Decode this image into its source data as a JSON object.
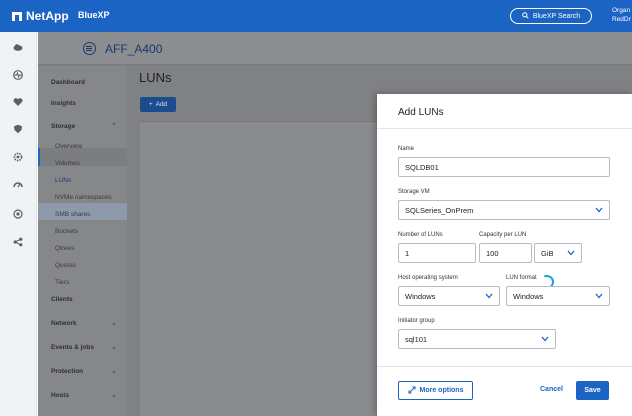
{
  "header": {
    "brand": "NetApp",
    "product": "BlueXP",
    "search_label": "BlueXP Search",
    "org_line1": "Organ",
    "org_line2": "RedDr"
  },
  "left_rail": {
    "icons": [
      "cloud-icon",
      "health-icon",
      "heart-shield-icon",
      "shield-icon",
      "gear-icon",
      "speed-icon",
      "target-icon",
      "share-icon"
    ]
  },
  "object": {
    "title": "AFF_A400"
  },
  "sidebar": {
    "items": [
      {
        "label": "Dashboard",
        "type": "top"
      },
      {
        "label": "Insights",
        "type": "top"
      },
      {
        "label": "Storage",
        "type": "top",
        "expanded": true
      },
      {
        "label": "Overview",
        "type": "sub"
      },
      {
        "label": "Volumes",
        "type": "sub"
      },
      {
        "label": "LUNs",
        "type": "sub",
        "active": true
      },
      {
        "label": "NVMe namespaces",
        "type": "sub"
      },
      {
        "label": "SMB shares",
        "type": "sub"
      },
      {
        "label": "Buckets",
        "type": "sub"
      },
      {
        "label": "Qtrees",
        "type": "sub"
      },
      {
        "label": "Quotas",
        "type": "sub"
      },
      {
        "label": "Tiers",
        "type": "sub"
      },
      {
        "label": "Clients",
        "type": "top"
      },
      {
        "label": "Network",
        "type": "top"
      },
      {
        "label": "Events & jobs",
        "type": "top"
      },
      {
        "label": "Protection",
        "type": "top"
      },
      {
        "label": "Hosts",
        "type": "top"
      }
    ]
  },
  "main": {
    "title": "LUNs",
    "add_label": "Add"
  },
  "modal": {
    "title": "Add LUNs",
    "name_label": "Name",
    "name_value": "SQLDB01",
    "svm_label": "Storage VM",
    "svm_value": "SQLSeries_OnPrem",
    "num_label": "Number of LUNs",
    "num_value": "1",
    "cap_label": "Capacity per LUN",
    "cap_value": "100",
    "unit_value": "GiB",
    "hostos_label": "Host operating system",
    "hostos_value": "Windows",
    "format_label": "LUN format",
    "format_value": "Windows",
    "igroup_label": "Initiator group",
    "igroup_value": "sql101",
    "more_label": "More options",
    "cancel_label": "Cancel",
    "save_label": "Save"
  },
  "colors": {
    "brand_blue": "#1b64c4",
    "overlay_gray": "#808184"
  }
}
